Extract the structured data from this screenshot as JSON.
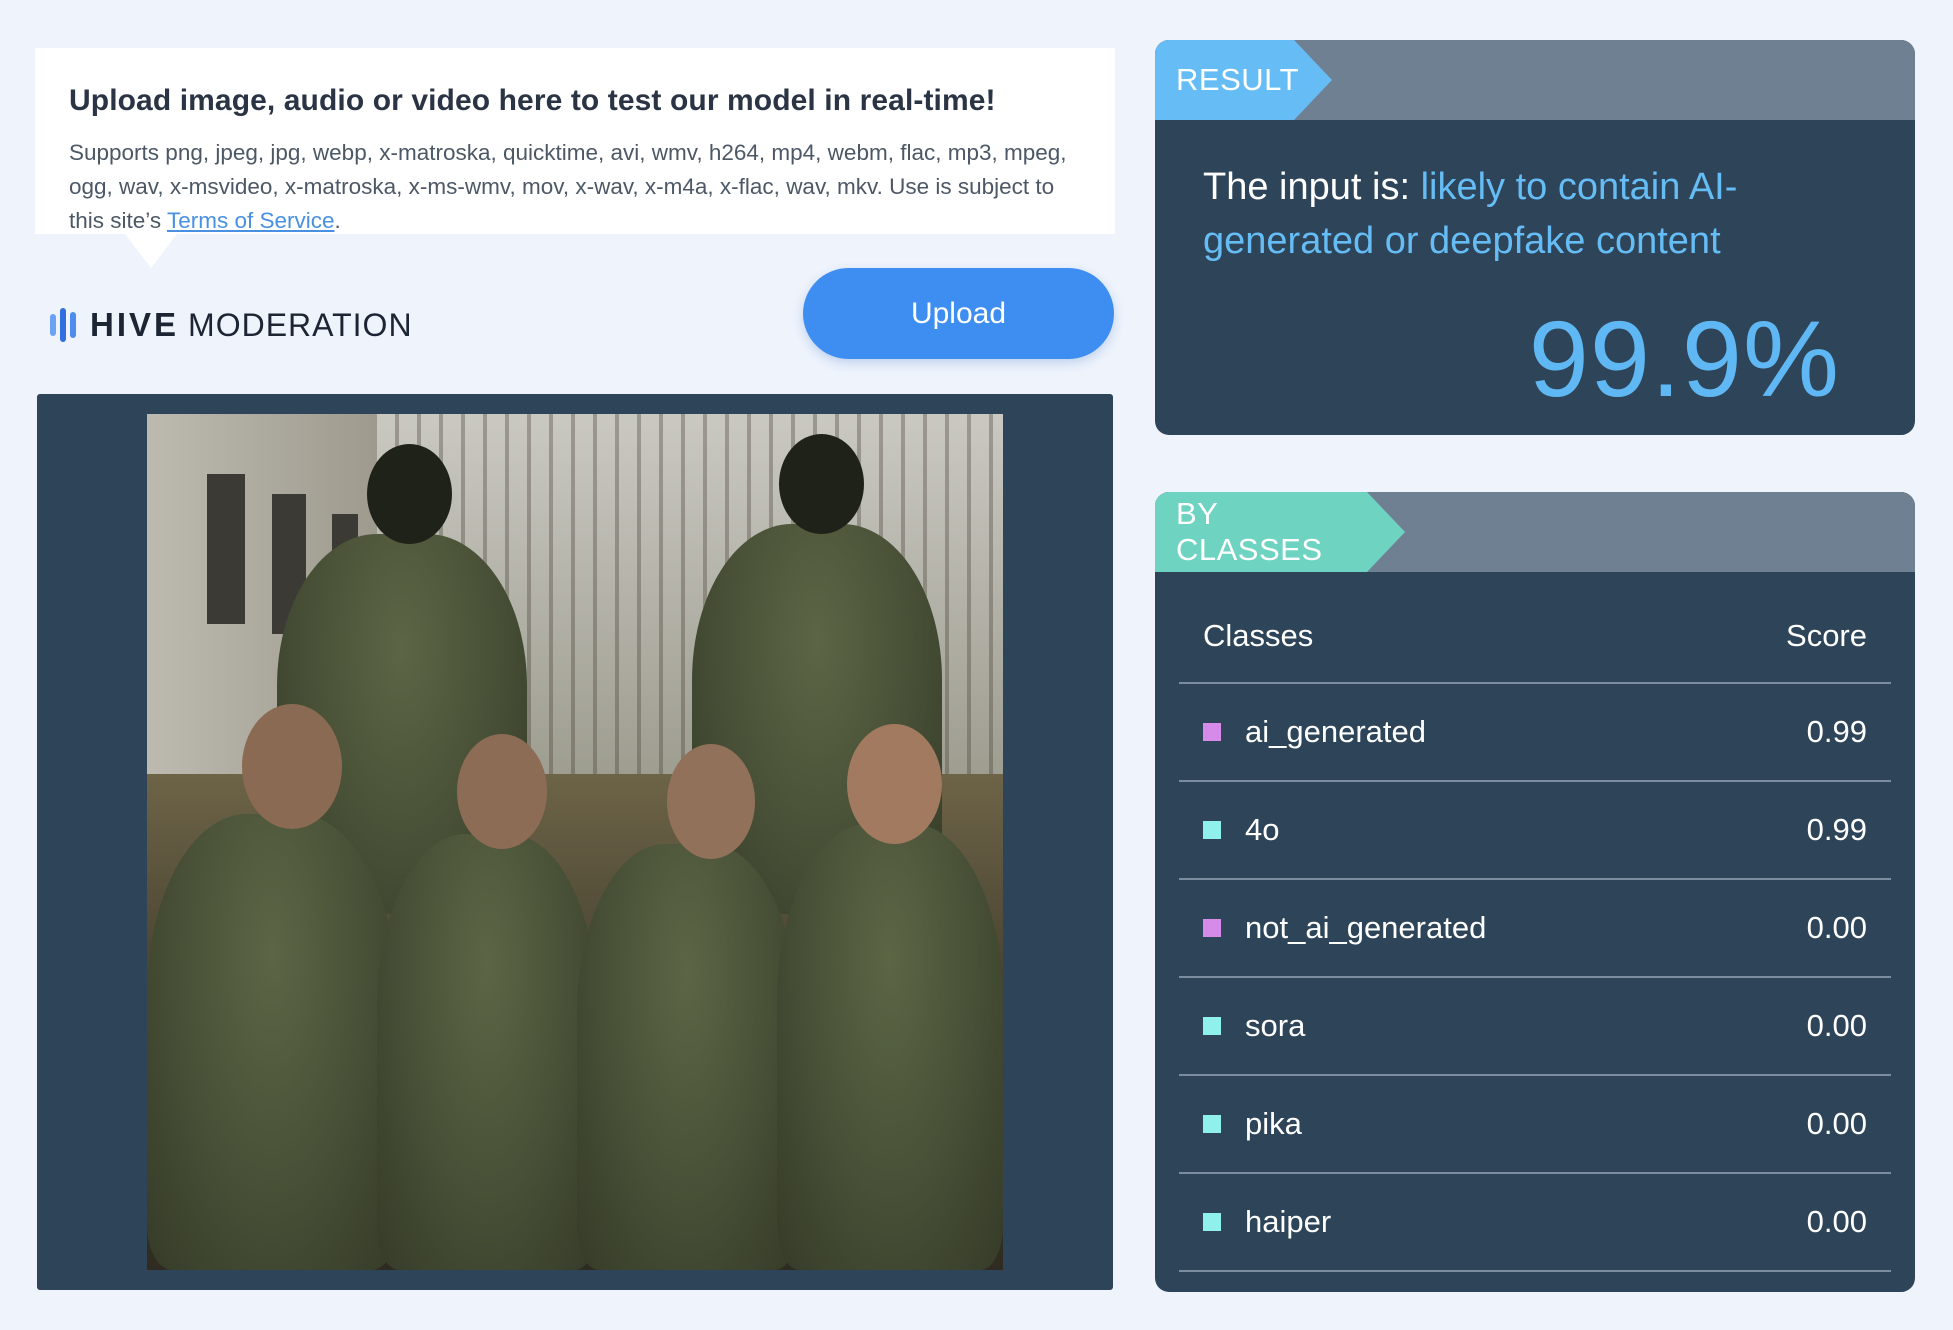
{
  "upload": {
    "title": "Upload image, audio or video here to test our model in real-time!",
    "supports_text": "Supports png, jpeg, jpg, webp, x-matroska, quicktime, avi, wmv, h264, mp4, webm, flac, mp3, mpeg, ogg, wav, x-msvideo, x-matroska, x-ms-wmv, mov, x-wav, x-m4a, x-flac, wav, mkv. Use is subject to this site’s ",
    "terms_link": "Terms of Service",
    "terms_suffix": ".",
    "button_label": "Upload"
  },
  "logo": {
    "brand": "HIVE",
    "product": "MODERATION",
    "icon": "sound-bars-icon"
  },
  "image_panel": {
    "alt": "uploaded-photo"
  },
  "result": {
    "tag": "RESULT",
    "prefix": "The input is: ",
    "verdict": "likely to contain AI-generated or deepfake content",
    "percentage": "99.9%"
  },
  "classes": {
    "tag": "BY CLASSES",
    "header_class": "Classes",
    "header_score": "Score",
    "rows": [
      {
        "name": "ai_generated",
        "score": "0.99",
        "color": "#d58be8"
      },
      {
        "name": "4o",
        "score": "0.99",
        "color": "#8ff0ec"
      },
      {
        "name": "not_ai_generated",
        "score": "0.00",
        "color": "#d58be8"
      },
      {
        "name": "sora",
        "score": "0.00",
        "color": "#8ff0ec"
      },
      {
        "name": "pika",
        "score": "0.00",
        "color": "#8ff0ec"
      },
      {
        "name": "haiper",
        "score": "0.00",
        "color": "#8ff0ec"
      }
    ]
  },
  "colors": {
    "accent_blue": "#3d8ef0",
    "result_blue": "#66bdf5",
    "classes_green": "#6ed3c0",
    "panel_bg": "#2d4459"
  }
}
